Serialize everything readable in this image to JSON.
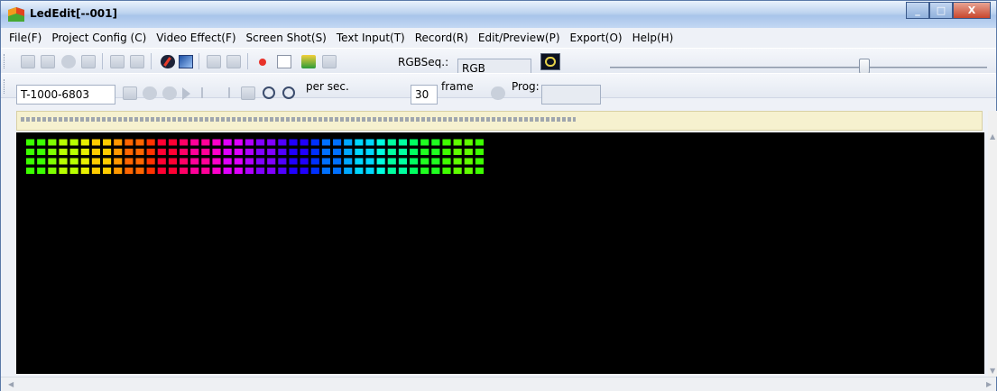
{
  "window": {
    "title": "LedEdit[--001]",
    "controls": {
      "minimize": "_",
      "maximize": "□",
      "close": "X"
    }
  },
  "menu": [
    "File(F)",
    "Project Config (C)",
    "Video Effect(F)",
    "Screen Shot(S)",
    "Text Input(T)",
    "Record(R)",
    "Edit/Preview(P)",
    "Export(O)",
    "Help(H)"
  ],
  "toolbar1": {
    "rgb_seq_label": "RGBSeq.:",
    "rgb_seq_value": "RGB",
    "icons": [
      "new-icon",
      "open-icon",
      "settings-icon",
      "save-icon",
      "copy-icon",
      "paste-icon",
      "brush-icon",
      "frame-icon",
      "image-icon",
      "film-icon",
      "record-icon",
      "stop-box-icon",
      "add-file-icon",
      "edit-icon",
      "preview-icon"
    ],
    "slider": {
      "position": 0.66
    }
  },
  "toolbar2": {
    "device_value": "T-1000-6803",
    "per_sec_label": "per sec.",
    "fps_value": "30",
    "frame_label": "frame",
    "prog_label": "Prog:",
    "prog_value": "",
    "icons": [
      "page-icon",
      "stop-icon",
      "pause-icon",
      "play-icon",
      "first-icon",
      "last-icon",
      "grid-icon",
      "zoom-in-icon",
      "zoom-out-icon",
      "loop-icon"
    ]
  },
  "led_preview": {
    "rows": 4,
    "cols": 42,
    "colors": [
      "#3cff00",
      "#7fff00",
      "#b8ff00",
      "#e8f000",
      "#ffcc00",
      "#ff9900",
      "#ff6600",
      "#ff3300",
      "#ff0033",
      "#ff0066",
      "#ff0099",
      "#ff00cc",
      "#e000ff",
      "#b000ff",
      "#8000ff",
      "#5000ff",
      "#2000ff",
      "#0030ff",
      "#0070ff",
      "#00a8ff",
      "#00d8ff",
      "#00ffe0",
      "#00ffa0",
      "#00ff60",
      "#20ff20",
      "#40ff00",
      "#60ff00",
      "#3cff00"
    ]
  }
}
